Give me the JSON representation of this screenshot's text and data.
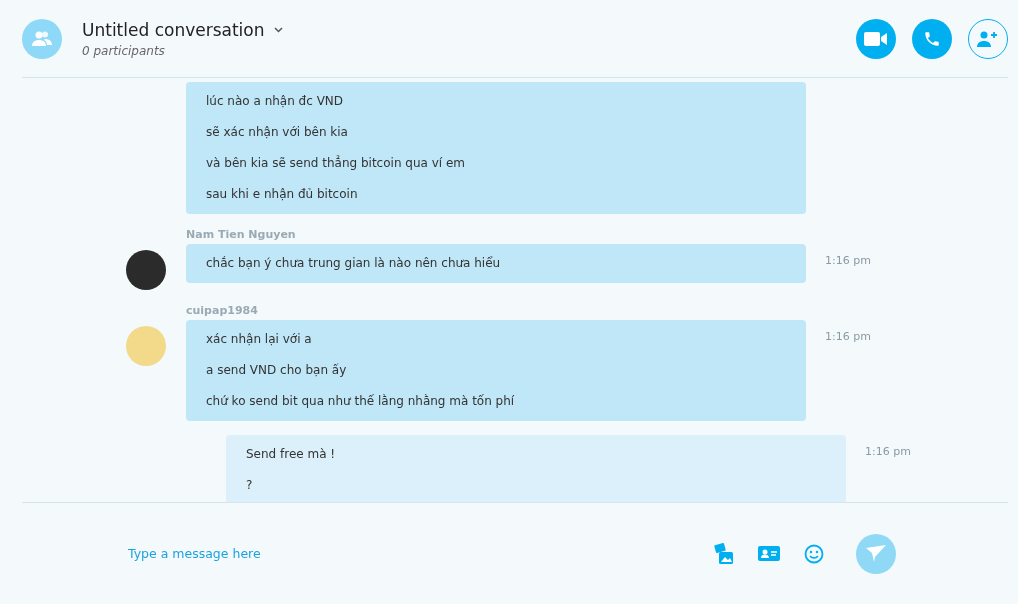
{
  "header": {
    "title": "Untitled conversation",
    "subtitle": "0 participants"
  },
  "messages": [
    {
      "outgoing": false,
      "lines": [
        "lúc nào a nhận đc VND",
        "sẽ xác nhận với bên kia",
        "và bên kia sẽ send thẳng bitcoin qua ví em",
        "sau khi e nhận đủ bitcoin"
      ]
    },
    {
      "outgoing": false,
      "sender": "Nam Tien Nguyen",
      "lines": [
        "chắc bạn ý chưa trung gian là nào nên chưa hiểu"
      ],
      "time": "1:16 pm"
    },
    {
      "outgoing": false,
      "sender": "cuipap1984",
      "lines": [
        "xác nhận lại với a",
        "a send VND cho bạn ấy",
        "chứ ko send bit qua như thế lằng nhằng mà tốn phí"
      ],
      "time": "1:16 pm"
    },
    {
      "outgoing": true,
      "lines": [
        "Send free mà !",
        "?"
      ],
      "time": "1:16 pm"
    }
  ],
  "composer": {
    "placeholder": "Type a message here"
  }
}
